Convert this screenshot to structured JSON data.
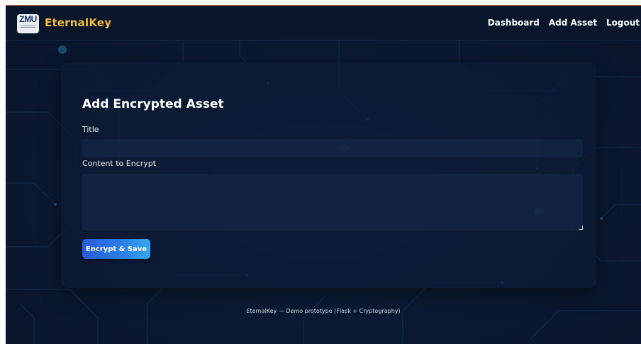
{
  "navbar": {
    "logo_text": "ZMU",
    "brand": "EternalKey",
    "links": [
      {
        "label": "Dashboard"
      },
      {
        "label": "Add Asset"
      },
      {
        "label": "Logout"
      }
    ]
  },
  "form": {
    "heading": "Add Encrypted Asset",
    "title_label": "Title",
    "title_value": "",
    "content_label": "Content to Encrypt",
    "content_value": "",
    "submit_label": "Encrypt & Save"
  },
  "footer": {
    "text": "EternalKey — Demo prototype (Flask + Cryptography)"
  },
  "colors": {
    "brand": "#f4bd2f",
    "background": "#0b1a33",
    "button": "#2a7fe8"
  }
}
